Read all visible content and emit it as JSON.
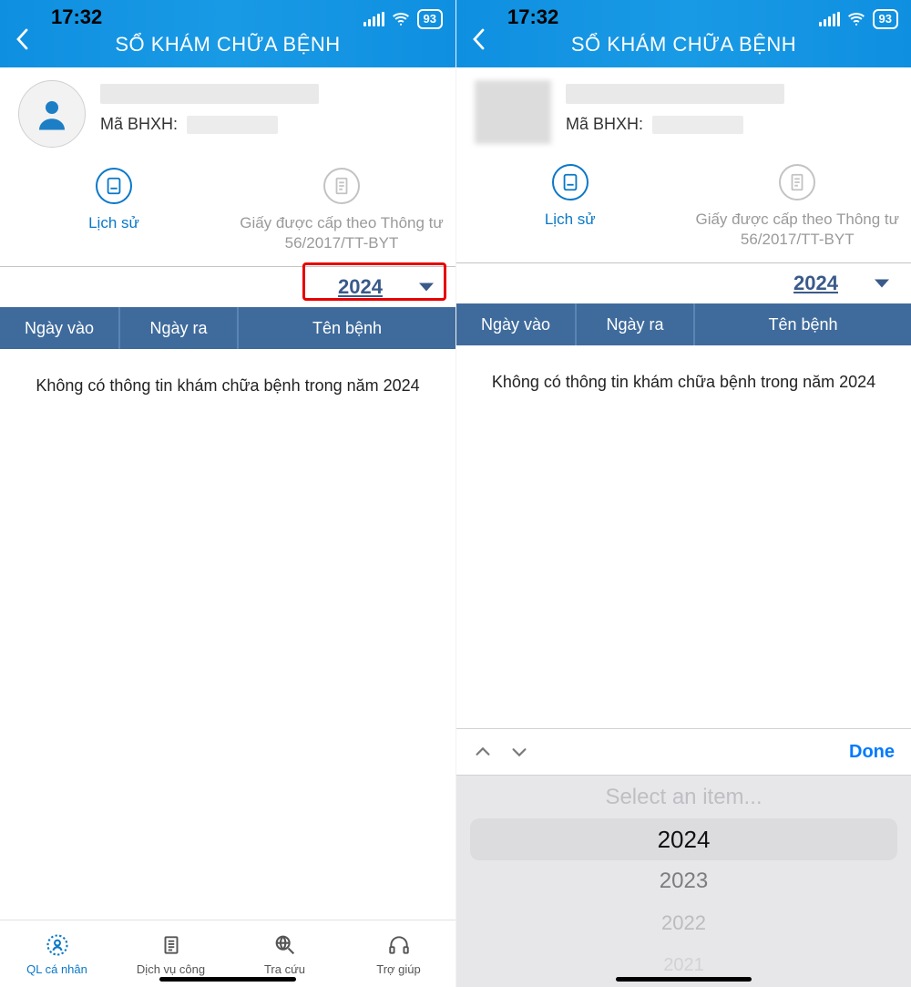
{
  "status": {
    "time": "17:32",
    "battery": "93"
  },
  "header": {
    "title": "SỔ KHÁM CHỮA BỆNH"
  },
  "profile": {
    "bhxh_label": "Mã BHXH:"
  },
  "tabs": {
    "history": "Lịch sử",
    "cert": "Giấy được cấp theo Thông tư 56/2017/TT-BYT"
  },
  "year": "2024",
  "columns": {
    "c1": "Ngày vào",
    "c2": "Ngày ra",
    "c3": "Tên bệnh"
  },
  "empty_msg": "Không có thông tin khám chữa bệnh trong năm 2024",
  "nav": {
    "n1": "QL cá nhân",
    "n2": "Dịch vụ công",
    "n3": "Tra cứu",
    "n4": "Trợ giúp"
  },
  "picker": {
    "done": "Done",
    "placeholder": "Select an item...",
    "y2024": "2024",
    "y2023": "2023",
    "y2022": "2022",
    "y2021": "2021"
  }
}
